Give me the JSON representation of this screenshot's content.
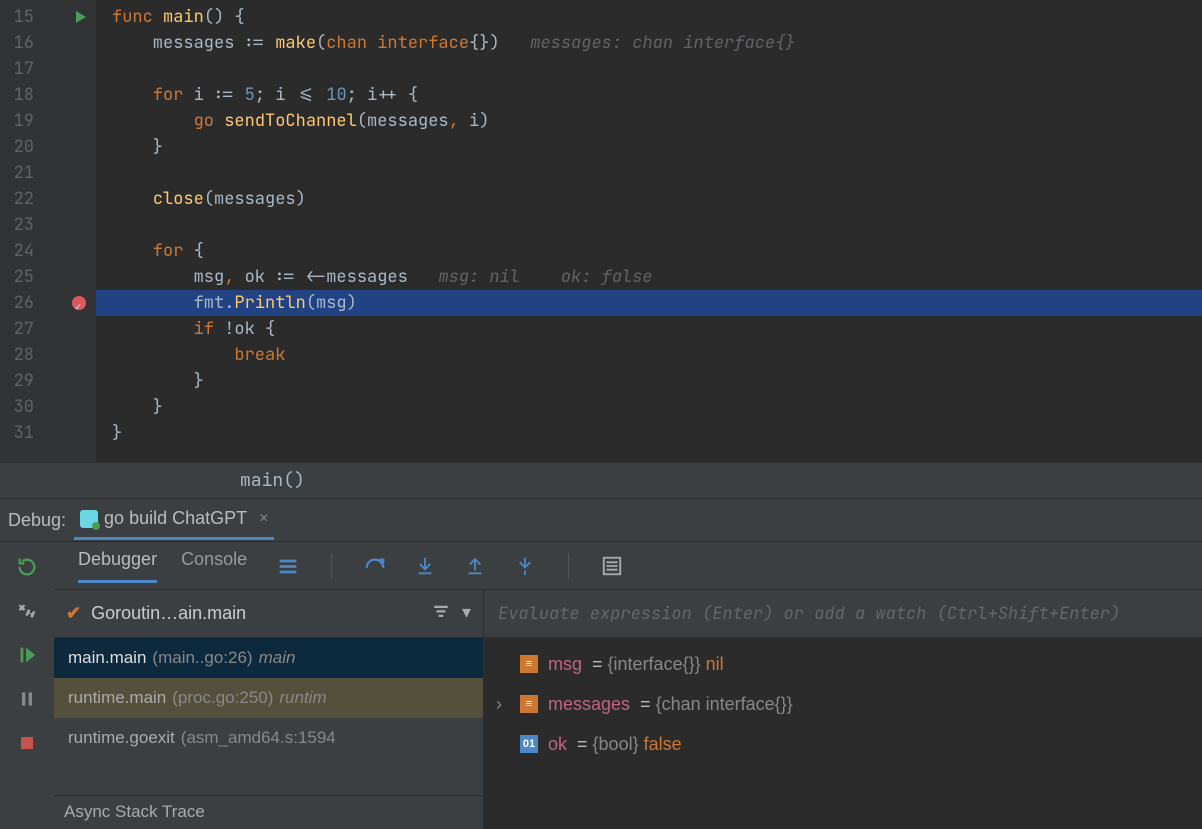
{
  "editor": {
    "lines": [
      {
        "n": 15,
        "run": true,
        "hl": false,
        "bp": false,
        "tokens": [
          {
            "t": "func ",
            "c": "kw"
          },
          {
            "t": "main",
            "c": "fn"
          },
          {
            "t": "() {",
            "c": "pn"
          }
        ],
        "hint": ""
      },
      {
        "n": 16,
        "hl": false,
        "tokens": [
          {
            "t": "    messages ",
            "c": "id"
          },
          {
            "t": ":=",
            "c": "pn"
          },
          {
            "t": " ",
            "c": "pn"
          },
          {
            "t": "make",
            "c": "fn"
          },
          {
            "t": "(",
            "c": "pn"
          },
          {
            "t": "chan ",
            "c": "ty"
          },
          {
            "t": "interface",
            "c": "kw"
          },
          {
            "t": "{})   ",
            "c": "pn"
          }
        ],
        "hint": "messages: chan interface{}"
      },
      {
        "n": 17,
        "tokens": [
          {
            "t": "",
            "c": "pn"
          }
        ]
      },
      {
        "n": 18,
        "tokens": [
          {
            "t": "    ",
            "c": "pn"
          },
          {
            "t": "for ",
            "c": "kw"
          },
          {
            "t": "i ",
            "c": "id"
          },
          {
            "t": ":=",
            "c": "pn"
          },
          {
            "t": " ",
            "c": "pn"
          },
          {
            "t": "5",
            "c": "nm"
          },
          {
            "t": "; i ",
            "c": "pn"
          },
          {
            "t": "<=",
            "c": "pn"
          },
          {
            "t": " ",
            "c": "pn"
          },
          {
            "t": "10",
            "c": "nm"
          },
          {
            "t": "; i",
            "c": "pn"
          },
          {
            "t": "++",
            "c": "pn"
          },
          {
            "t": " {",
            "c": "pn"
          }
        ]
      },
      {
        "n": 19,
        "tokens": [
          {
            "t": "        ",
            "c": "pn"
          },
          {
            "t": "go ",
            "c": "kw"
          },
          {
            "t": "sendToChannel",
            "c": "fn"
          },
          {
            "t": "(messages",
            "c": "pn"
          },
          {
            "t": ",",
            "c": "kw"
          },
          {
            "t": " i)",
            "c": "pn"
          }
        ]
      },
      {
        "n": 20,
        "tokens": [
          {
            "t": "    }",
            "c": "pn"
          }
        ]
      },
      {
        "n": 21,
        "tokens": [
          {
            "t": "",
            "c": "pn"
          }
        ]
      },
      {
        "n": 22,
        "tokens": [
          {
            "t": "    ",
            "c": "pn"
          },
          {
            "t": "close",
            "c": "fn"
          },
          {
            "t": "(messages)",
            "c": "pn"
          }
        ]
      },
      {
        "n": 23,
        "tokens": [
          {
            "t": "",
            "c": "pn"
          }
        ]
      },
      {
        "n": 24,
        "tokens": [
          {
            "t": "    ",
            "c": "pn"
          },
          {
            "t": "for ",
            "c": "kw"
          },
          {
            "t": "{",
            "c": "pn"
          }
        ]
      },
      {
        "n": 25,
        "tokens": [
          {
            "t": "        msg",
            "c": "id"
          },
          {
            "t": ",",
            "c": "kw"
          },
          {
            "t": " ok ",
            "c": "id"
          },
          {
            "t": ":=",
            "c": "pn"
          },
          {
            "t": " <-messages   ",
            "c": "pn"
          }
        ],
        "hint": "msg: nil    ok: false"
      },
      {
        "n": 26,
        "hl": true,
        "bp": true,
        "tokens": [
          {
            "t": "        fmt.",
            "c": "id"
          },
          {
            "t": "Println",
            "c": "fn"
          },
          {
            "t": "(msg)",
            "c": "pn"
          }
        ]
      },
      {
        "n": 27,
        "tokens": [
          {
            "t": "        ",
            "c": "pn"
          },
          {
            "t": "if ",
            "c": "kw"
          },
          {
            "t": "!ok {",
            "c": "pn"
          }
        ]
      },
      {
        "n": 28,
        "tokens": [
          {
            "t": "            ",
            "c": "pn"
          },
          {
            "t": "break",
            "c": "kw"
          }
        ]
      },
      {
        "n": 29,
        "tokens": [
          {
            "t": "        }",
            "c": "pn"
          }
        ]
      },
      {
        "n": 30,
        "tokens": [
          {
            "t": "    }",
            "c": "pn"
          }
        ]
      },
      {
        "n": 31,
        "tokens": [
          {
            "t": "}",
            "c": "pn"
          }
        ]
      }
    ],
    "context": "main()"
  },
  "debug": {
    "title": "Debug:",
    "config": "go build ChatGPT",
    "tabs": {
      "debugger": "Debugger",
      "console": "Console"
    },
    "thread": "Goroutin…ain.main",
    "frames": [
      {
        "sel": true,
        "name": "main.main",
        "loc": "(main..go:26)",
        "pkg": "main"
      },
      {
        "alt": true,
        "name": "runtime.main",
        "loc": "(proc.go:250)",
        "pkg": "runtim"
      },
      {
        "name": "runtime.goexit",
        "loc": "(asm_amd64.s:1594",
        "pkg": ""
      }
    ],
    "async": "Async Stack Trace",
    "eval_placeholder": "Evaluate expression (Enter) or add a watch (Ctrl+Shift+Enter)",
    "vars": [
      {
        "expand": "",
        "icon": "struct",
        "name": "msg",
        "eq": " = ",
        "type": "{interface{}}",
        "val": " nil",
        "valKw": true
      },
      {
        "expand": "›",
        "icon": "struct",
        "name": "messages",
        "eq": " = ",
        "type": "{chan interface{}}",
        "val": "",
        "valKw": false
      },
      {
        "expand": "",
        "icon": "prim",
        "iconText": "01",
        "name": "ok",
        "eq": " = ",
        "type": "{bool}",
        "val": " false",
        "valKw": true
      }
    ]
  }
}
